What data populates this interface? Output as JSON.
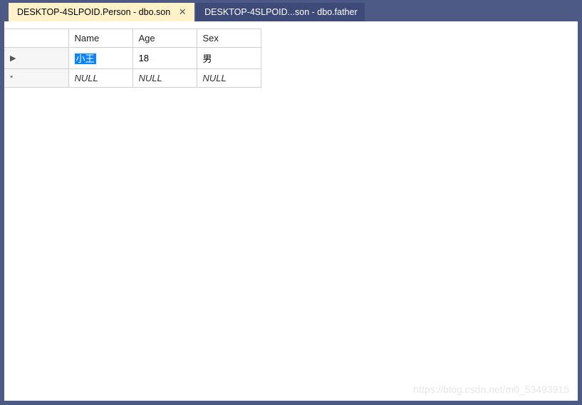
{
  "tabs": [
    {
      "label": "DESKTOP-4SLPOID.Person - dbo.son",
      "active": true
    },
    {
      "label": "DESKTOP-4SLPOID...son - dbo.father",
      "active": false
    }
  ],
  "table": {
    "columns": [
      "Name",
      "Age",
      "Sex"
    ],
    "rows": [
      {
        "indicator": "▶",
        "cells": [
          "小王",
          "18",
          "男"
        ],
        "selectedCol": 0,
        "null": false
      },
      {
        "indicator": "*",
        "cells": [
          "NULL",
          "NULL",
          "NULL"
        ],
        "selectedCol": -1,
        "null": true
      }
    ]
  },
  "watermark": "https://blog.csdn.net/m0_53493915"
}
